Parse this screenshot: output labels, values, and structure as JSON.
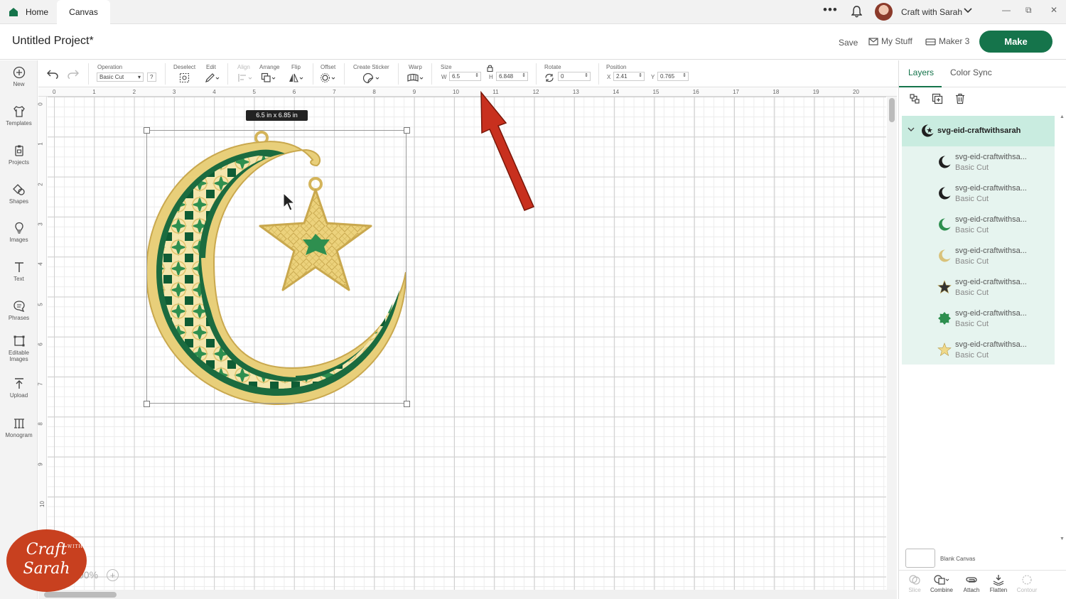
{
  "topbar": {
    "tab_home": "Home",
    "tab_canvas": "Canvas",
    "more": "•••",
    "account_name": "Craft with Sarah",
    "minimize": "—",
    "maximize": "⧉",
    "close": "✕"
  },
  "header": {
    "project_title": "Untitled Project*",
    "save": "Save",
    "my_stuff": "My Stuff",
    "machine": "Maker 3",
    "make": "Make"
  },
  "sidebar": {
    "items": [
      {
        "label": "New",
        "icon": "plus-circle-icon"
      },
      {
        "label": "Templates",
        "icon": "shirt-icon"
      },
      {
        "label": "Projects",
        "icon": "clipboard-icon"
      },
      {
        "label": "Shapes",
        "icon": "shapes-icon"
      },
      {
        "label": "Images",
        "icon": "lightbulb-icon"
      },
      {
        "label": "Text",
        "icon": "text-icon"
      },
      {
        "label": "Phrases",
        "icon": "speech-bubble-icon"
      },
      {
        "label": "Editable",
        "label2": "Images",
        "icon": "edit-image-icon"
      },
      {
        "label": "Upload",
        "icon": "upload-icon"
      },
      {
        "label": "Monogram",
        "icon": "monogram-icon"
      }
    ]
  },
  "toolbar": {
    "operation_label": "Operation",
    "operation_value": "Basic Cut",
    "operation_help": "?",
    "deselect": "Deselect",
    "edit": "Edit",
    "align": "Align",
    "arrange": "Arrange",
    "flip": "Flip",
    "offset": "Offset",
    "create_sticker": "Create Sticker",
    "warp": "Warp",
    "size": "Size",
    "w_label": "W",
    "w_value": "6.5",
    "h_label": "H",
    "h_value": "6.848",
    "rotate": "Rotate",
    "rotate_value": "0",
    "position": "Position",
    "x_label": "X",
    "x_value": "2.41",
    "y_label": "Y",
    "y_value": "0.765"
  },
  "rulers": {
    "top": [
      "0",
      "1",
      "2",
      "3",
      "4",
      "5",
      "6",
      "7",
      "8",
      "9",
      "10",
      "11",
      "12",
      "13",
      "14",
      "15",
      "16",
      "17",
      "18",
      "19",
      "20"
    ],
    "left": [
      "0",
      "1",
      "2",
      "3",
      "4",
      "5",
      "6",
      "7",
      "8",
      "9",
      "10"
    ]
  },
  "canvas": {
    "dimension_badge": "6.5  in x 6.85  in",
    "zoom": "00%",
    "zoom_plus": "+"
  },
  "logo": {
    "line1": "Craft",
    "with": "WITH",
    "line2": "Sarah"
  },
  "panel": {
    "tab_layers": "Layers",
    "tab_color_sync": "Color Sync",
    "group_name": "svg-eid-craftwithsarah",
    "layers": [
      {
        "name": "svg-eid-craftwithsa...",
        "op": "Basic Cut",
        "color": "#1f1f1f",
        "shape": "moon"
      },
      {
        "name": "svg-eid-craftwithsa...",
        "op": "Basic Cut",
        "color": "#1f1f1f",
        "shape": "moon"
      },
      {
        "name": "svg-eid-craftwithsa...",
        "op": "Basic Cut",
        "color": "#2e8f4f",
        "shape": "moon"
      },
      {
        "name": "svg-eid-craftwithsa...",
        "op": "Basic Cut",
        "color": "#d9c27a",
        "shape": "moon"
      },
      {
        "name": "svg-eid-craftwithsa...",
        "op": "Basic Cut",
        "color": "#333333",
        "shape": "star"
      },
      {
        "name": "svg-eid-craftwithsa...",
        "op": "Basic Cut",
        "color": "#2e8f4f",
        "shape": "badge"
      },
      {
        "name": "svg-eid-craftwithsa...",
        "op": "Basic Cut",
        "color": "#efd98a",
        "shape": "star"
      }
    ],
    "blank_canvas": "Blank Canvas",
    "actions": [
      "Slice",
      "Combine",
      "Attach",
      "Flatten",
      "Contour"
    ]
  },
  "colors": {
    "accent": "#15744b",
    "gold": "#e8cf7a",
    "gold_light": "#f6e8b0",
    "green_dark": "#0f5c34",
    "green_mid": "#2e8f4f",
    "arrow": "#c8301e"
  }
}
